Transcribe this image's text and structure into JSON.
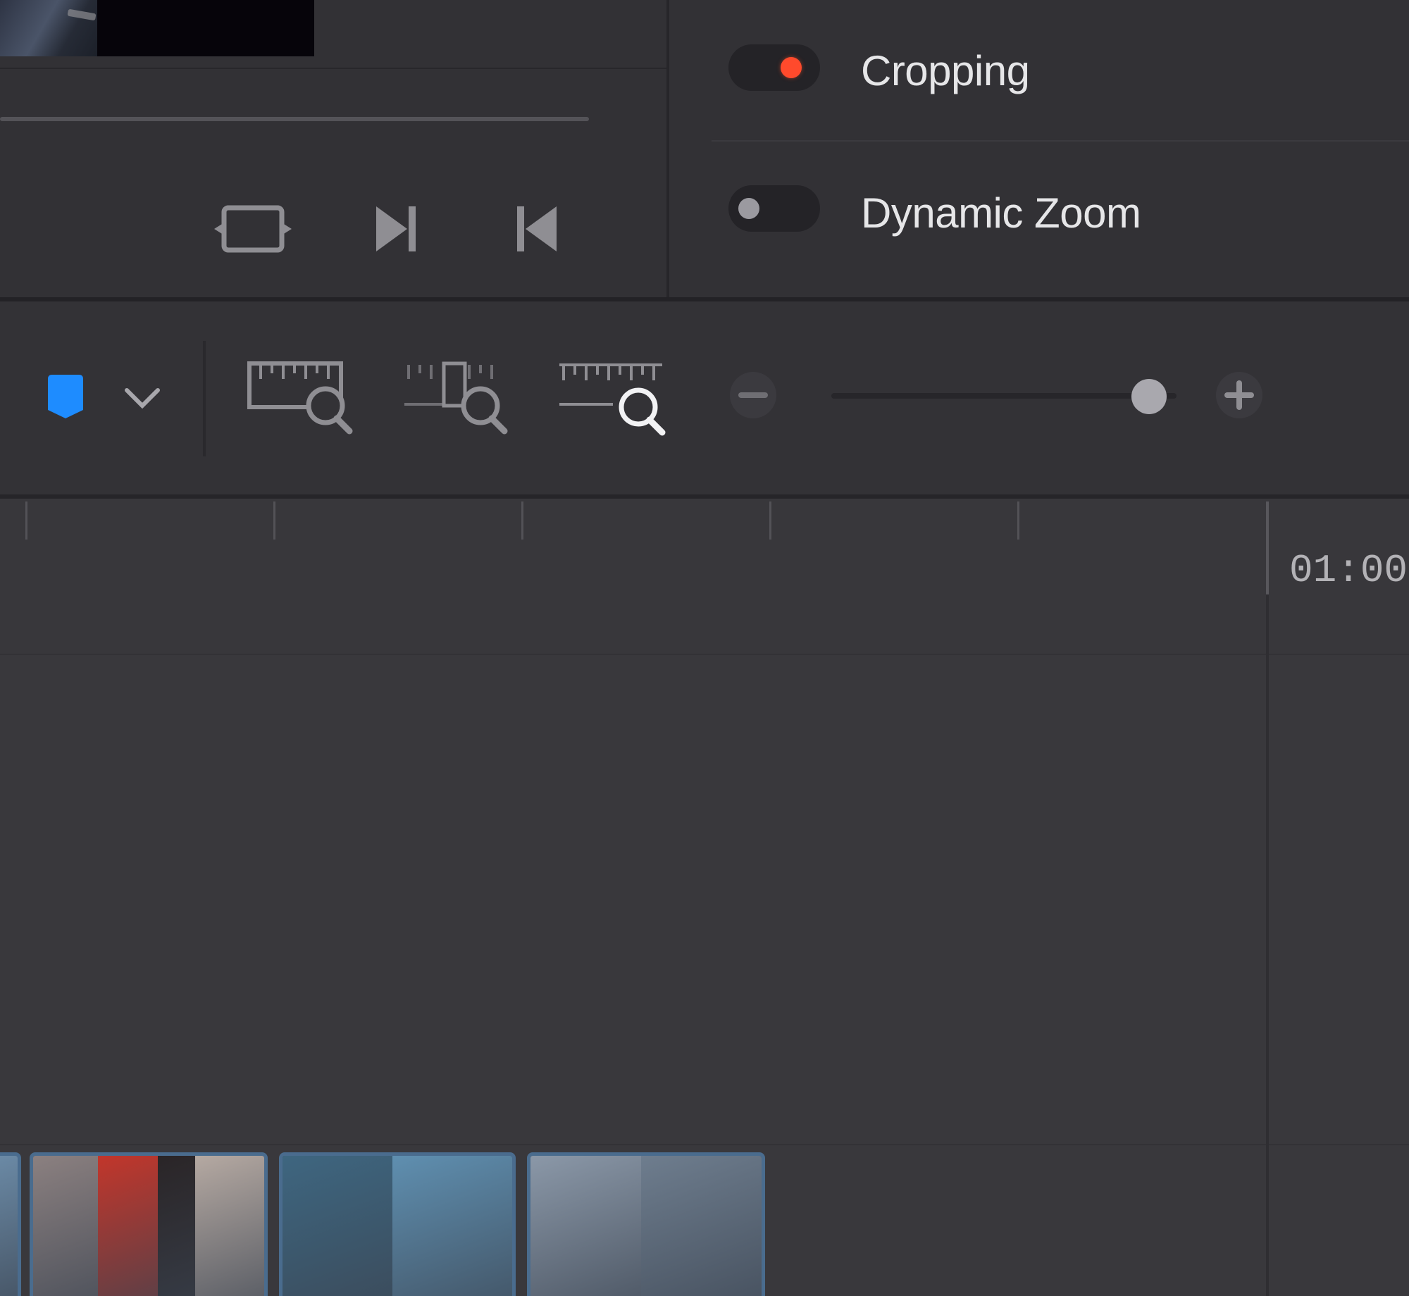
{
  "inspector": {
    "options": [
      {
        "label": "Cropping",
        "enabled": true,
        "accent": "#ff4a2c"
      },
      {
        "label": "Dynamic Zoom",
        "enabled": false
      }
    ]
  },
  "viewer": {
    "controls": [
      "fit-icon",
      "next-clip-icon",
      "previous-clip-icon"
    ]
  },
  "toolbar": {
    "flag_color": "#1e8cff",
    "zoom_modes": [
      "full-extent-zoom-icon",
      "detail-zoom-icon",
      "custom-zoom-icon"
    ],
    "active_zoom_mode": "custom-zoom-icon",
    "zoom_level": 0.92
  },
  "timeline": {
    "timecode": "01:00:"
  },
  "clips": [
    {
      "colors": [
        "#6b8aa6"
      ]
    },
    {
      "colors": [
        "#8b8080",
        "#c2362b",
        "#2a2527",
        "#b5a9a2"
      ]
    },
    {
      "colors": [
        "#3e6680",
        "#5f8fb0"
      ]
    },
    {
      "colors": [
        "#8b98a8",
        "#6e7d8e"
      ]
    }
  ]
}
